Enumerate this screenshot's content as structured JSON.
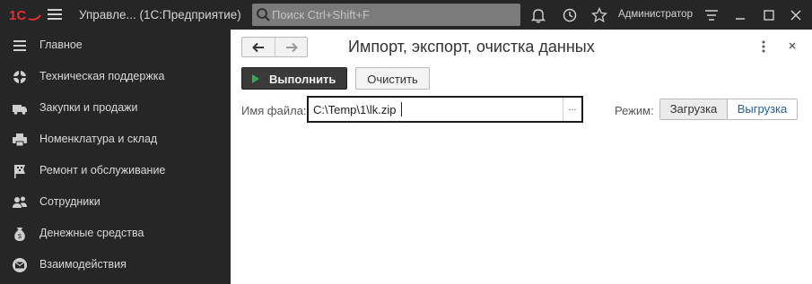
{
  "colors": {
    "accent_green": "#2fb04a",
    "link_blue": "#1f5fa8",
    "dark_bg": "#262626",
    "logo_red": "#e0302d"
  },
  "topbar": {
    "logo": "1C",
    "app_title": "Управле...  (1С:Предприятие)",
    "search_placeholder": "Поиск Ctrl+Shift+F",
    "icons": [
      "bell-icon",
      "history-icon",
      "star-icon"
    ],
    "user": "Администратор",
    "controls": [
      "settings-menu-icon",
      "minimize-icon",
      "maximize-icon",
      "close-icon"
    ]
  },
  "sidebar": {
    "items": [
      {
        "label": "Главное",
        "icon": "menu-lines-icon"
      },
      {
        "label": "Техническая поддержка",
        "icon": "support-icon"
      },
      {
        "label": "Закупки и продажи",
        "icon": "truck-icon"
      },
      {
        "label": "Номенклатура и склад",
        "icon": "printer-icon"
      },
      {
        "label": "Ремонт и обслуживание",
        "icon": "flag-icon"
      },
      {
        "label": "Сотрудники",
        "icon": "people-icon"
      },
      {
        "label": "Денежные средства",
        "icon": "money-bag-icon"
      },
      {
        "label": "Взаимодействия",
        "icon": "envelope-icon"
      }
    ]
  },
  "form": {
    "title": "Импорт, экспорт, очистка данных",
    "run_label": "Выполнить",
    "clear_label": "Очистить",
    "file_label": "Имя файла:",
    "file_value": "C:\\Temp\\1\\lk.zip",
    "browse_label": "...",
    "mode_label": "Режим:",
    "modes": [
      "Загрузка",
      "Выгрузка"
    ],
    "selected_mode": "Выгрузка"
  }
}
